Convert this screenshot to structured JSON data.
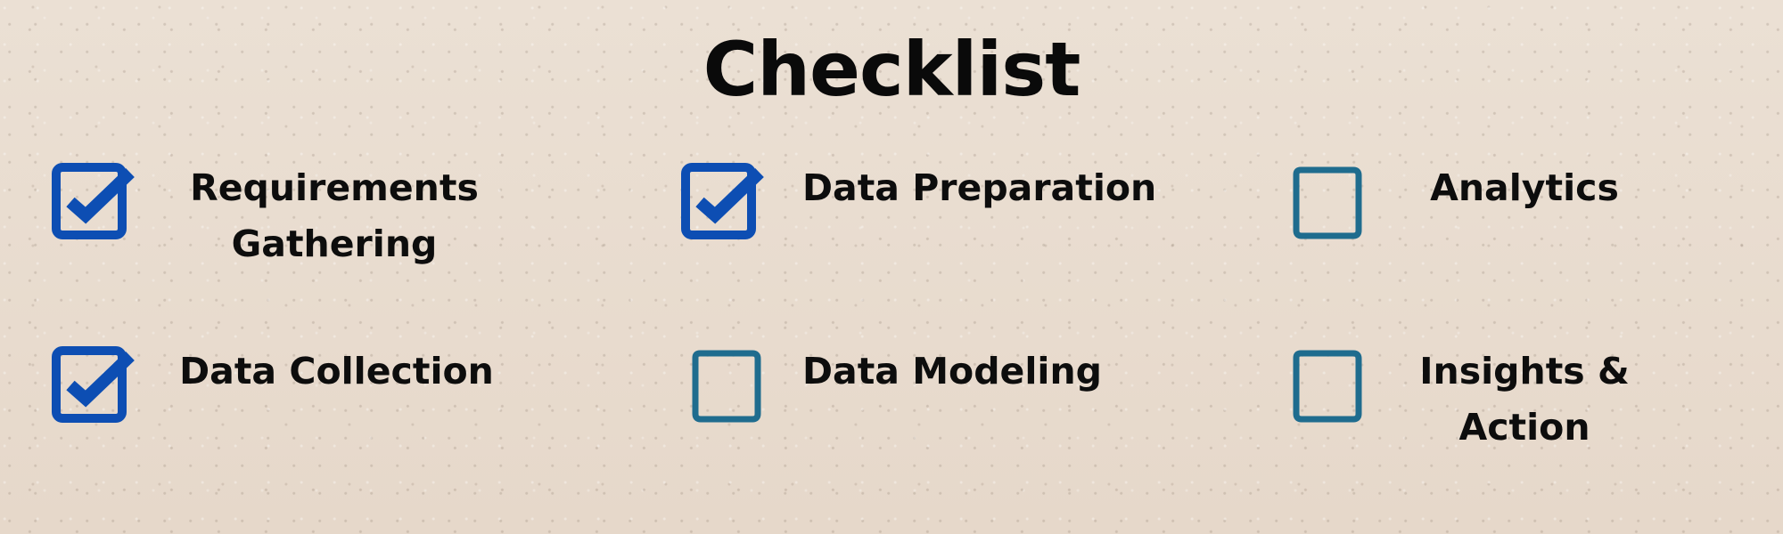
{
  "title": "Checklist",
  "colors": {
    "background": "#e9dccf",
    "checked_box": "#0d4eb3",
    "unchecked_box": "#1f6c8e",
    "text": "#0c0c0c"
  },
  "checklist": {
    "items": [
      {
        "line1": "Requirements",
        "line2": "Gathering",
        "checked": true,
        "icon": "checked-box-icon"
      },
      {
        "line1": "Data Preparation",
        "line2": "",
        "checked": true,
        "icon": "checked-box-icon"
      },
      {
        "line1": "Analytics",
        "line2": "",
        "checked": false,
        "icon": "empty-box-icon"
      },
      {
        "line1": "Data Collection",
        "line2": "",
        "checked": true,
        "icon": "checked-box-icon"
      },
      {
        "line1": "Data Modeling",
        "line2": "",
        "checked": false,
        "icon": "empty-box-icon"
      },
      {
        "line1": "Insights &",
        "line2": "Action",
        "checked": false,
        "icon": "empty-box-icon"
      }
    ]
  }
}
